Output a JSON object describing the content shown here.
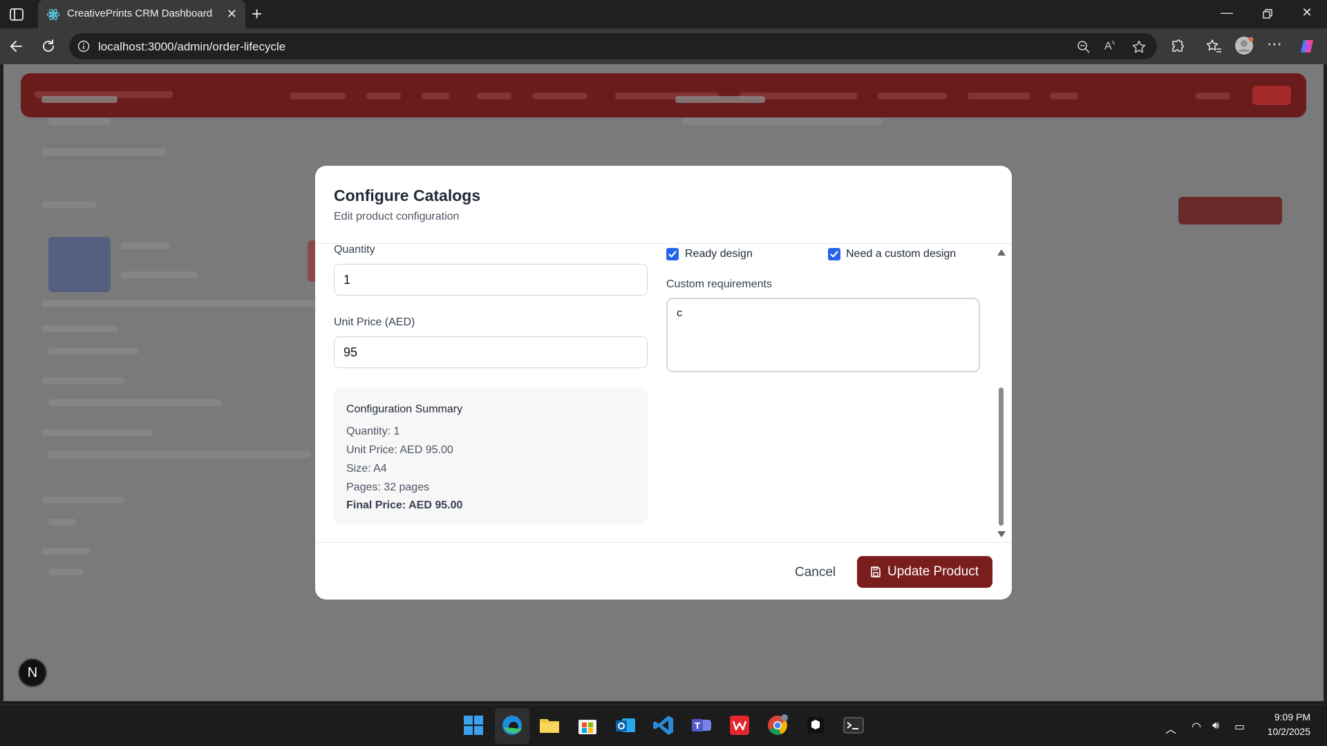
{
  "browser": {
    "tab_title": "CreativePrints CRM Dashboard",
    "address": "localhost:3000/admin/order-lifecycle"
  },
  "modal": {
    "title": "Configure Catalogs",
    "subtitle": "Edit product configuration",
    "quantity_label": "Quantity",
    "quantity_value": "1",
    "unit_price_label": "Unit Price (AED)",
    "unit_price_value": "95",
    "summary": {
      "title": "Configuration Summary",
      "quantity": "Quantity: 1",
      "unit_price": "Unit Price: AED 95.00",
      "size": "Size: A4",
      "pages": "Pages: 32 pages",
      "final_price": "Final Price: AED 95.00"
    },
    "ready_design_label": "Ready design",
    "ready_design_checked": true,
    "custom_design_label": "Need a custom design",
    "custom_design_checked": true,
    "custom_requirements_label": "Custom requirements",
    "custom_requirements_value": "c",
    "cancel_label": "Cancel",
    "update_label": "Update Product"
  },
  "taskbar": {
    "time": "9:09 PM",
    "date": "10/2/2025"
  },
  "colors": {
    "brand": "#7a1d1d",
    "checkbox": "#2563eb"
  }
}
